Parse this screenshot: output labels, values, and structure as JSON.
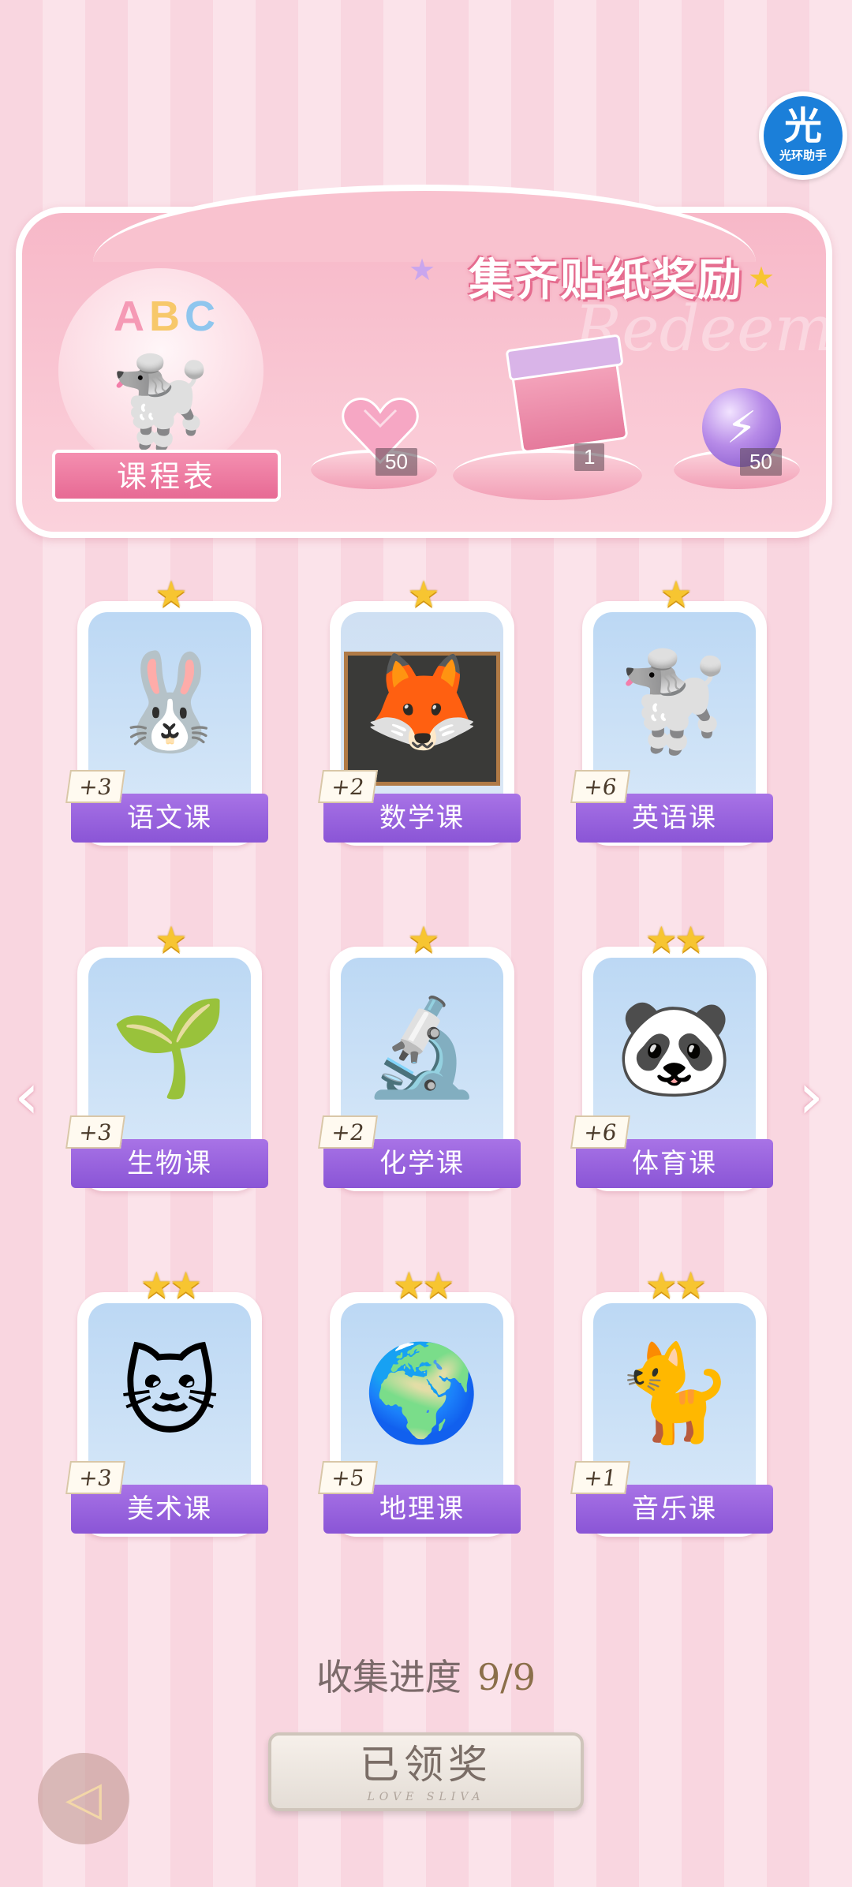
{
  "assistant": {
    "glyph": "光",
    "label": "光环助手"
  },
  "banner": {
    "title": "集齐贴纸奖励",
    "watermark": "Redeem",
    "schedule": {
      "letters": [
        "A",
        "B",
        "C"
      ],
      "label": "课程表"
    },
    "rewards": [
      {
        "icon": "heart-gem-icon",
        "count": "50"
      },
      {
        "icon": "gift-box-icon",
        "count": "1"
      },
      {
        "icon": "energy-orb-icon",
        "count": "50"
      }
    ]
  },
  "cards": [
    {
      "name": "语文课",
      "bonus": "+3",
      "stars": "★",
      "star_count": 1,
      "icon": "rabbit-calligraphy-icon",
      "emoji": "🐰"
    },
    {
      "name": "数学课",
      "bonus": "+2",
      "stars": "★",
      "star_count": 1,
      "icon": "fox-teacher-icon",
      "emoji": "🦊"
    },
    {
      "name": "英语课",
      "bonus": "+6",
      "stars": "★",
      "star_count": 1,
      "icon": "poodle-reading-icon",
      "emoji": "🐩"
    },
    {
      "name": "生物课",
      "bonus": "+3",
      "stars": "★",
      "star_count": 1,
      "icon": "sprout-sun-icon",
      "emoji": "🌱"
    },
    {
      "name": "化学课",
      "bonus": "+2",
      "stars": "★",
      "star_count": 1,
      "icon": "microscope-icon",
      "emoji": "🔬"
    },
    {
      "name": "体育课",
      "bonus": "+6",
      "stars": "★★",
      "star_count": 2,
      "icon": "panda-pingpong-icon",
      "emoji": "🐼"
    },
    {
      "name": "美术课",
      "bonus": "+3",
      "stars": "★★",
      "star_count": 2,
      "icon": "cat-painter-icon",
      "emoji": "🐱"
    },
    {
      "name": "地理课",
      "bonus": "+5",
      "stars": "★★",
      "star_count": 2,
      "icon": "globe-icon",
      "emoji": "🌍"
    },
    {
      "name": "音乐课",
      "bonus": "+1",
      "stars": "★★",
      "star_count": 2,
      "icon": "cat-keyboard-icon",
      "emoji": "🐈"
    }
  ],
  "navigation": {
    "prev": "‹",
    "next": "›",
    "back": "◁"
  },
  "progress": {
    "label": "收集进度",
    "value": "9/9"
  },
  "claim_button": {
    "label": "已领奖",
    "sub": "LOVE SLIVA"
  },
  "colors": {
    "stripe_light": "#fbe3ea",
    "stripe_dark": "#f9d6e0",
    "label_purple": "#9460dc",
    "star_gold": "#f7c531",
    "banner_pink": "#f7b8c8"
  }
}
